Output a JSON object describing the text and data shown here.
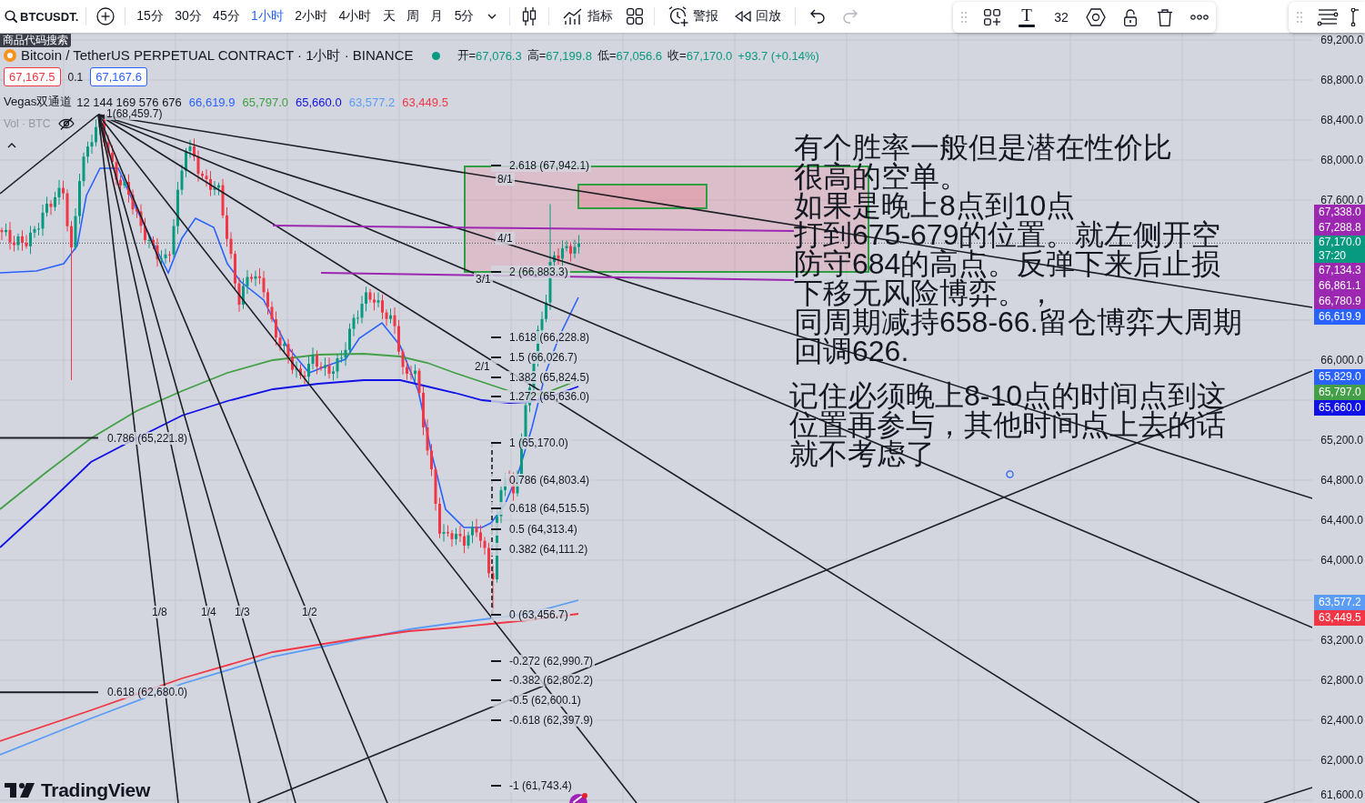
{
  "toolbar": {
    "symbol": "BTCUSDT.",
    "intervals": [
      {
        "label": "15分",
        "selected": false
      },
      {
        "label": "30分",
        "selected": false
      },
      {
        "label": "45分",
        "selected": false
      },
      {
        "label": "1小时",
        "selected": true
      },
      {
        "label": "2小时",
        "selected": false
      },
      {
        "label": "4小时",
        "selected": false
      },
      {
        "label": "天",
        "selected": false
      },
      {
        "label": "周",
        "selected": false
      },
      {
        "label": "月",
        "selected": false
      },
      {
        "label": "5分",
        "selected": false
      }
    ],
    "actions": [
      {
        "kind": "chart_type"
      },
      {
        "kind": "indicators",
        "label": "指标"
      },
      {
        "kind": "layouts"
      },
      {
        "kind": "alert",
        "label": "警报"
      },
      {
        "kind": "replay",
        "label": "回放"
      }
    ],
    "history": [
      {
        "kind": "undo",
        "disabled": false
      },
      {
        "kind": "redo",
        "disabled": true
      }
    ]
  },
  "tooltip": "商品代码搜索",
  "drawing_toolbar": {
    "text_glyph": "T",
    "font_size": "32"
  },
  "legend": {
    "title": "Bitcoin / TetherUS PERPETUAL CONTRACT · 1小时 · BINANCE",
    "ohlc": [
      {
        "label": "开=",
        "value": "67,076.3"
      },
      {
        "label": "高=",
        "value": "67,199.8"
      },
      {
        "label": "低=",
        "value": "67,056.6"
      },
      {
        "label": "收=",
        "value": "67,170.0"
      }
    ],
    "change": "+93.7 (+0.14%)",
    "sell": "67,167.5",
    "spread": "0.1",
    "buy": "67,167.6",
    "indicator": {
      "name": "Vegas双通道",
      "params": "12 144 169 576 676",
      "values": [
        {
          "value": "66,619.9",
          "color": "#2962ff"
        },
        {
          "value": "65,797.0",
          "color": "#43a047"
        },
        {
          "value": "65,660.0",
          "color": "#1010e8"
        },
        {
          "value": "63,577.2",
          "color": "#5b9cf6"
        },
        {
          "value": "63,449.5",
          "color": "#f23645"
        }
      ]
    },
    "volume": "Vol · BTC"
  },
  "chart": {
    "anchor_label": "1(68,459.7)",
    "fib_levels": [
      "2.618 (67,942.1)",
      "2 (66,883.3)",
      "1.618 (66,228.8)",
      "1.5 (66,026.7)",
      "1.382 (65,824.5)",
      "1.272 (65,636.0)",
      "1 (65,170.0)",
      "0.786 (64,803.4)",
      "0.618 (64,515.5)",
      "0.5 (64,313.4)",
      "0.382 (64,111.2)",
      "0 (63,456.7)",
      "-0.272 (62,990.7)",
      "-0.382 (62,802.2)",
      "-0.5 (62,600.1)",
      "-0.618 (62,397.9)",
      "-1 (61,743.4)"
    ],
    "fan_labels": [
      "8/1",
      "4/1",
      "3/1",
      "2/1",
      "1/8",
      "1/4",
      "1/3",
      "1/2"
    ],
    "retracements": [
      "0.786 (65,221.8)",
      "0.618 (62,680.0)"
    ],
    "notes": [
      {
        "lines": [
          "有个胜率一般但是潜在性价比",
          "很高的空单。",
          "如果是晚上8点到10点",
          "打到675-679的位置。就左侧开空",
          "防守684的高点。反弹下来后止损",
          "下移无风险博弈。，",
          "同周期减持658-66.留仓博弈大周期",
          "回调626."
        ]
      },
      {
        "lines": [
          "记住必须晚上8-10点的时间点到这",
          "位置再参与，其他时间点上去的话",
          "就不考虑了"
        ]
      }
    ]
  },
  "price_axis": {
    "ticks": [
      "69,200.0",
      "68,800.0",
      "68,400.0",
      "68,000.0",
      "67,600.0",
      "66,000.0",
      "65,200.0",
      "64,800.0",
      "64,400.0",
      "64,000.0",
      "63,200.0",
      "62,800.0",
      "62,400.0",
      "62,000.0",
      "61,600.0"
    ],
    "badges": [
      {
        "kind": "level",
        "value": "67,338.0",
        "color": "#9c27b0"
      },
      {
        "kind": "level",
        "value": "67,288.8",
        "color": "#9c27b0"
      },
      {
        "kind": "current",
        "value": "67,170.0",
        "countdown": "37:20",
        "color": "#089981"
      },
      {
        "kind": "level",
        "value": "67,134.3",
        "color": "#9c27b0"
      },
      {
        "kind": "level",
        "value": "66,861.1",
        "color": "#9c27b0"
      },
      {
        "kind": "level",
        "value": "66,780.9",
        "color": "#9c27b0"
      },
      {
        "kind": "level",
        "value": "66,619.9",
        "color": "#2962ff"
      },
      {
        "kind": "level",
        "value": "65,829.0",
        "color": "#2962ff"
      },
      {
        "kind": "level",
        "value": "65,797.0",
        "color": "#43a047"
      },
      {
        "kind": "level",
        "value": "65,660.0",
        "color": "#1010e8"
      },
      {
        "kind": "level",
        "value": "63,577.2",
        "color": "#5b9cf6"
      },
      {
        "kind": "level",
        "value": "63,449.5",
        "color": "#f23645"
      }
    ]
  },
  "logo": "TradingView"
}
